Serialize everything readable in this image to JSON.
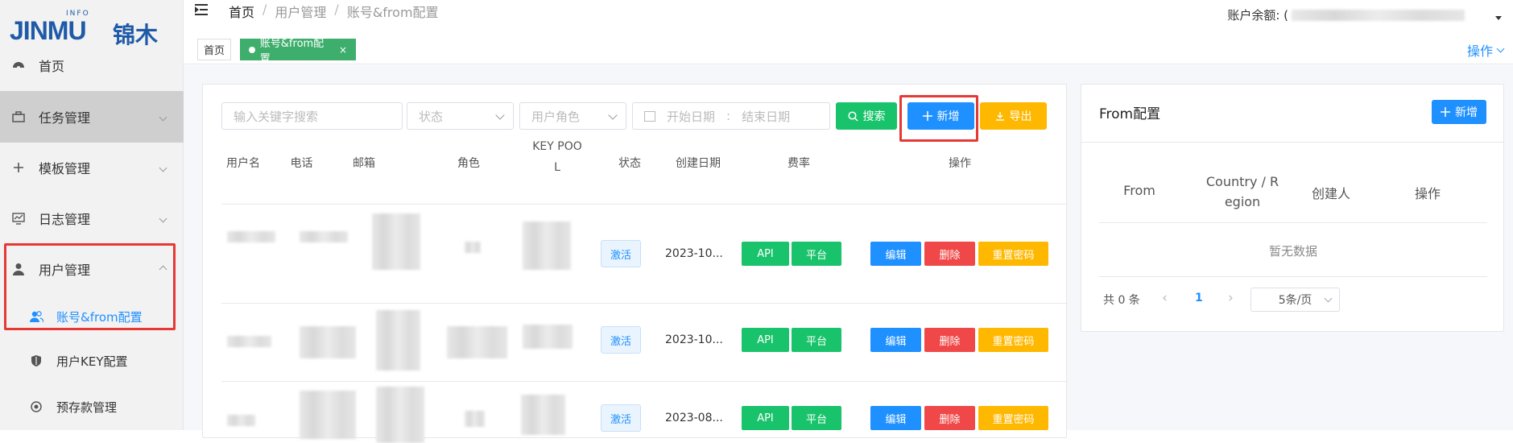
{
  "logo": {
    "brand": "JINMU",
    "tag": "INFO",
    "cn": "锦木"
  },
  "sidebar": {
    "items": [
      {
        "label": "首页",
        "icon": "dashboard-icon"
      },
      {
        "label": "任务管理",
        "icon": "briefcase-icon"
      },
      {
        "label": "模板管理",
        "icon": "plus-icon"
      },
      {
        "label": "日志管理",
        "icon": "monitor-chart-icon"
      },
      {
        "label": "用户管理",
        "icon": "user-icon"
      }
    ],
    "subitems": [
      {
        "label": "账号&from配置",
        "icon": "users-icon"
      },
      {
        "label": "用户KEY配置",
        "icon": "shield-icon"
      },
      {
        "label": "预存款管理",
        "icon": "coins-icon"
      }
    ]
  },
  "header": {
    "breadcrumb": [
      "首页",
      "用户管理",
      "账号&from配置"
    ],
    "balance_label": "账户余额: ("
  },
  "tabs": [
    {
      "label": "首页"
    },
    {
      "label": "账号&from配置",
      "close": "×"
    }
  ],
  "top_ops": "操作",
  "filters": {
    "keyword_placeholder": "输入关键字搜索",
    "status_placeholder": "状态",
    "role_placeholder": "用户角色",
    "start_date": "开始日期",
    "date_sep": ":",
    "end_date": "结束日期",
    "search_label": "搜索",
    "add_label": "新增",
    "export_label": "导出"
  },
  "table": {
    "headers": [
      "用户名",
      "电话",
      "邮箱",
      "角色",
      "KEY POO",
      "L",
      "状态",
      "创建日期",
      "费率",
      "操作"
    ],
    "rows": [
      {
        "status": "激活",
        "date": "2023-10...",
        "api": "API",
        "platform": "平台",
        "edit": "编辑",
        "delete": "删除",
        "reset": "重置密码"
      },
      {
        "status": "激活",
        "date": "2023-10...",
        "api": "API",
        "platform": "平台",
        "edit": "编辑",
        "delete": "删除",
        "reset": "重置密码"
      },
      {
        "status": "激活",
        "date": "2023-08...",
        "api": "API",
        "platform": "平台",
        "edit": "编辑",
        "delete": "删除",
        "reset": "重置密码"
      }
    ]
  },
  "from_panel": {
    "title": "From配置",
    "add_label": "新增",
    "headers": [
      "From",
      "Country / R",
      "egion",
      "创建人",
      "操作"
    ],
    "empty": "暂无数据",
    "total": "共 0 条",
    "page": "1",
    "page_size": "5条/页"
  },
  "colors": {
    "accent": "#1e90ff",
    "green": "#19c36b",
    "yellow": "#ffb800",
    "red": "#f04848",
    "tab_green": "#3dae6b"
  }
}
